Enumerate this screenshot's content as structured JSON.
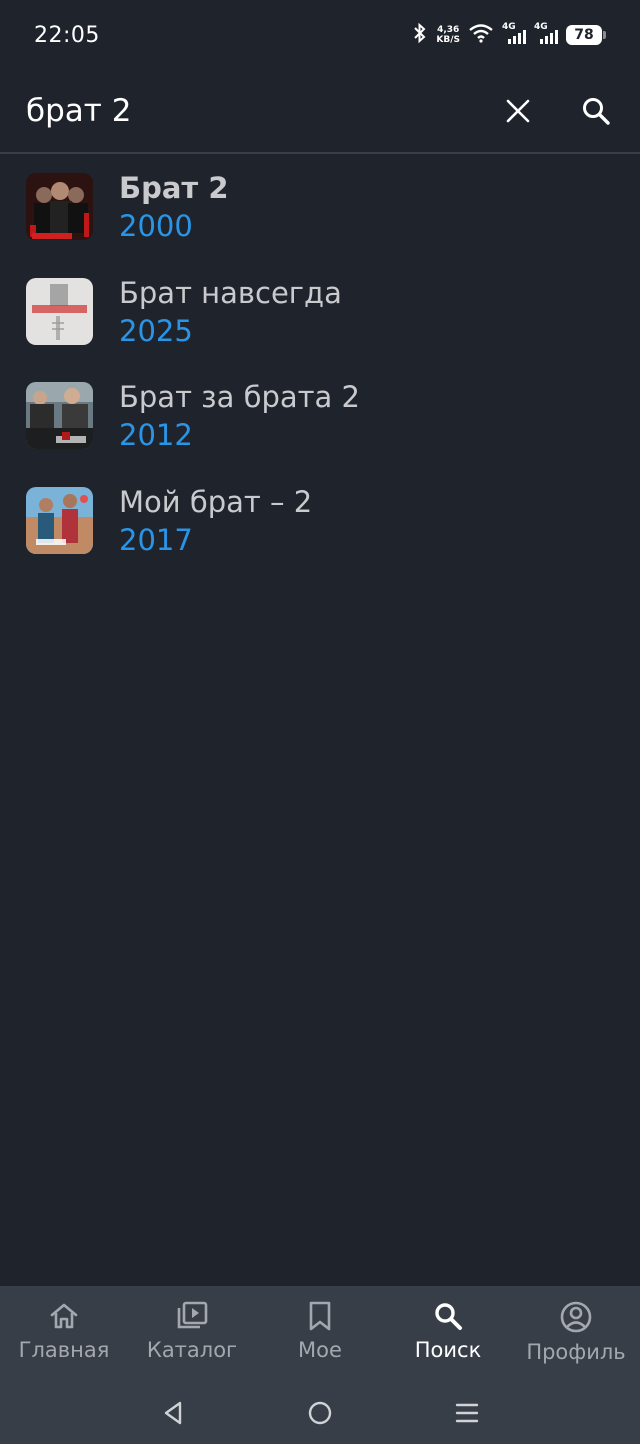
{
  "status": {
    "time": "22:05",
    "net_speed_value": "4,36",
    "net_speed_unit": "KB/S",
    "net1": "4G",
    "net2": "4G",
    "battery": "78"
  },
  "search": {
    "query": "брат 2"
  },
  "results": [
    {
      "title": "Брат 2",
      "year": "2000",
      "thumb": "brat2-poster"
    },
    {
      "title": "Брат навсегда",
      "year": "2025",
      "thumb": "brat-navsegda-poster"
    },
    {
      "title": "Брат за брата 2",
      "year": "2012",
      "thumb": "brat-za-brata-2-poster"
    },
    {
      "title": "Мой брат – 2",
      "year": "2017",
      "thumb": "moy-brat-2-poster"
    }
  ],
  "bottom_nav": [
    {
      "label": "Главная",
      "icon": "home-icon"
    },
    {
      "label": "Каталог",
      "icon": "catalog-icon"
    },
    {
      "label": "Мое",
      "icon": "bookmark-icon"
    },
    {
      "label": "Поиск",
      "icon": "search-icon"
    },
    {
      "label": "Профиль",
      "icon": "profile-icon"
    }
  ],
  "colors": {
    "background": "#1f232b",
    "accent_year": "#2a94e6",
    "nav_bar": "#383e48"
  }
}
